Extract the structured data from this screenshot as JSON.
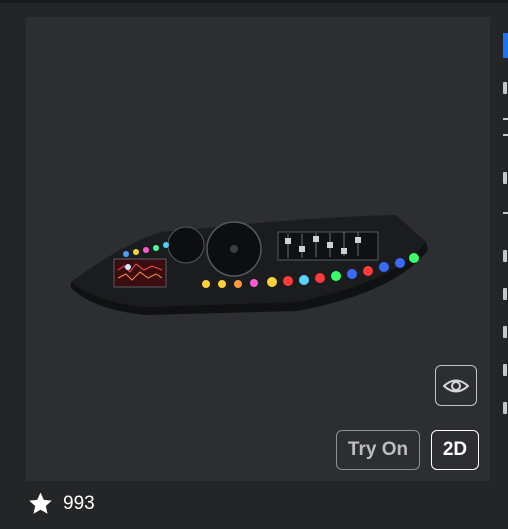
{
  "preview": {
    "eye_icon": "eye-icon",
    "try_on_label": "Try On",
    "view_2d_label": "2D"
  },
  "rating": {
    "icon": "star-icon",
    "count": "993"
  },
  "colors": {
    "page_background": "#232527",
    "preview_background": "#2c2e31",
    "accent_blue": "#1a74f0"
  }
}
